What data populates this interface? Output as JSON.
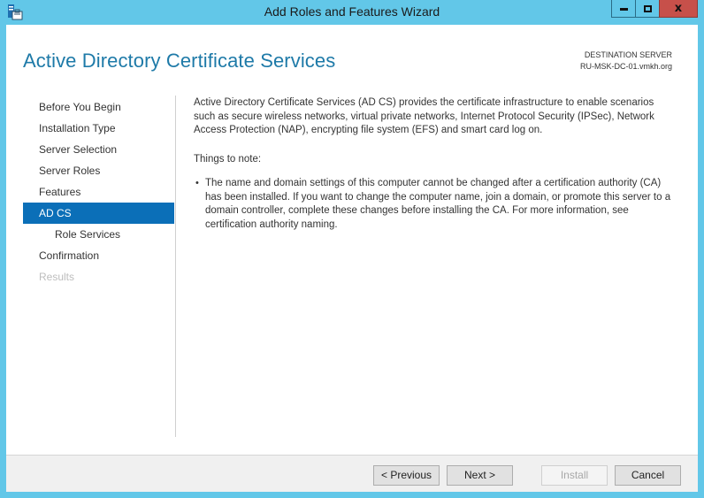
{
  "window": {
    "title": "Add Roles and Features Wizard",
    "icon": "server-manager-icon",
    "controls": {
      "minimize": "minimize-icon",
      "maximize": "maximize-icon",
      "close": "close-icon",
      "close_glyph": "x"
    },
    "close_color": "#c7504a",
    "frame_color": "#62c7e8"
  },
  "header": {
    "page_title": "Active Directory Certificate Services",
    "destination_label": "DESTINATION SERVER",
    "destination_server": "RU-MSK-DC-01.vmkh.org"
  },
  "nav": {
    "active_color": "#0b6fb8",
    "items": [
      {
        "label": "Before You Begin",
        "state": "normal"
      },
      {
        "label": "Installation Type",
        "state": "normal"
      },
      {
        "label": "Server Selection",
        "state": "normal"
      },
      {
        "label": "Server Roles",
        "state": "normal"
      },
      {
        "label": "Features",
        "state": "normal"
      },
      {
        "label": "AD CS",
        "state": "active"
      },
      {
        "label": "Role Services",
        "state": "sub"
      },
      {
        "label": "Confirmation",
        "state": "normal"
      },
      {
        "label": "Results",
        "state": "disabled"
      }
    ]
  },
  "content": {
    "intro": "Active Directory Certificate Services (AD CS) provides the certificate infrastructure to enable scenarios such as secure wireless networks, virtual private networks, Internet Protocol Security (IPSec), Network Access Protection (NAP), encrypting file system (EFS) and smart card log on.",
    "notes_heading": "Things to note:",
    "bullet": "•",
    "notes": [
      "The name and domain settings of this computer cannot be changed after a certification authority (CA) has been installed. If you want to change the computer name, join a domain, or promote this server to a domain controller, complete these changes before installing the CA. For more information, see certification authority naming."
    ]
  },
  "footer": {
    "previous_label": "< Previous",
    "next_label": "Next >",
    "install_label": "Install",
    "install_enabled": false,
    "cancel_label": "Cancel"
  }
}
